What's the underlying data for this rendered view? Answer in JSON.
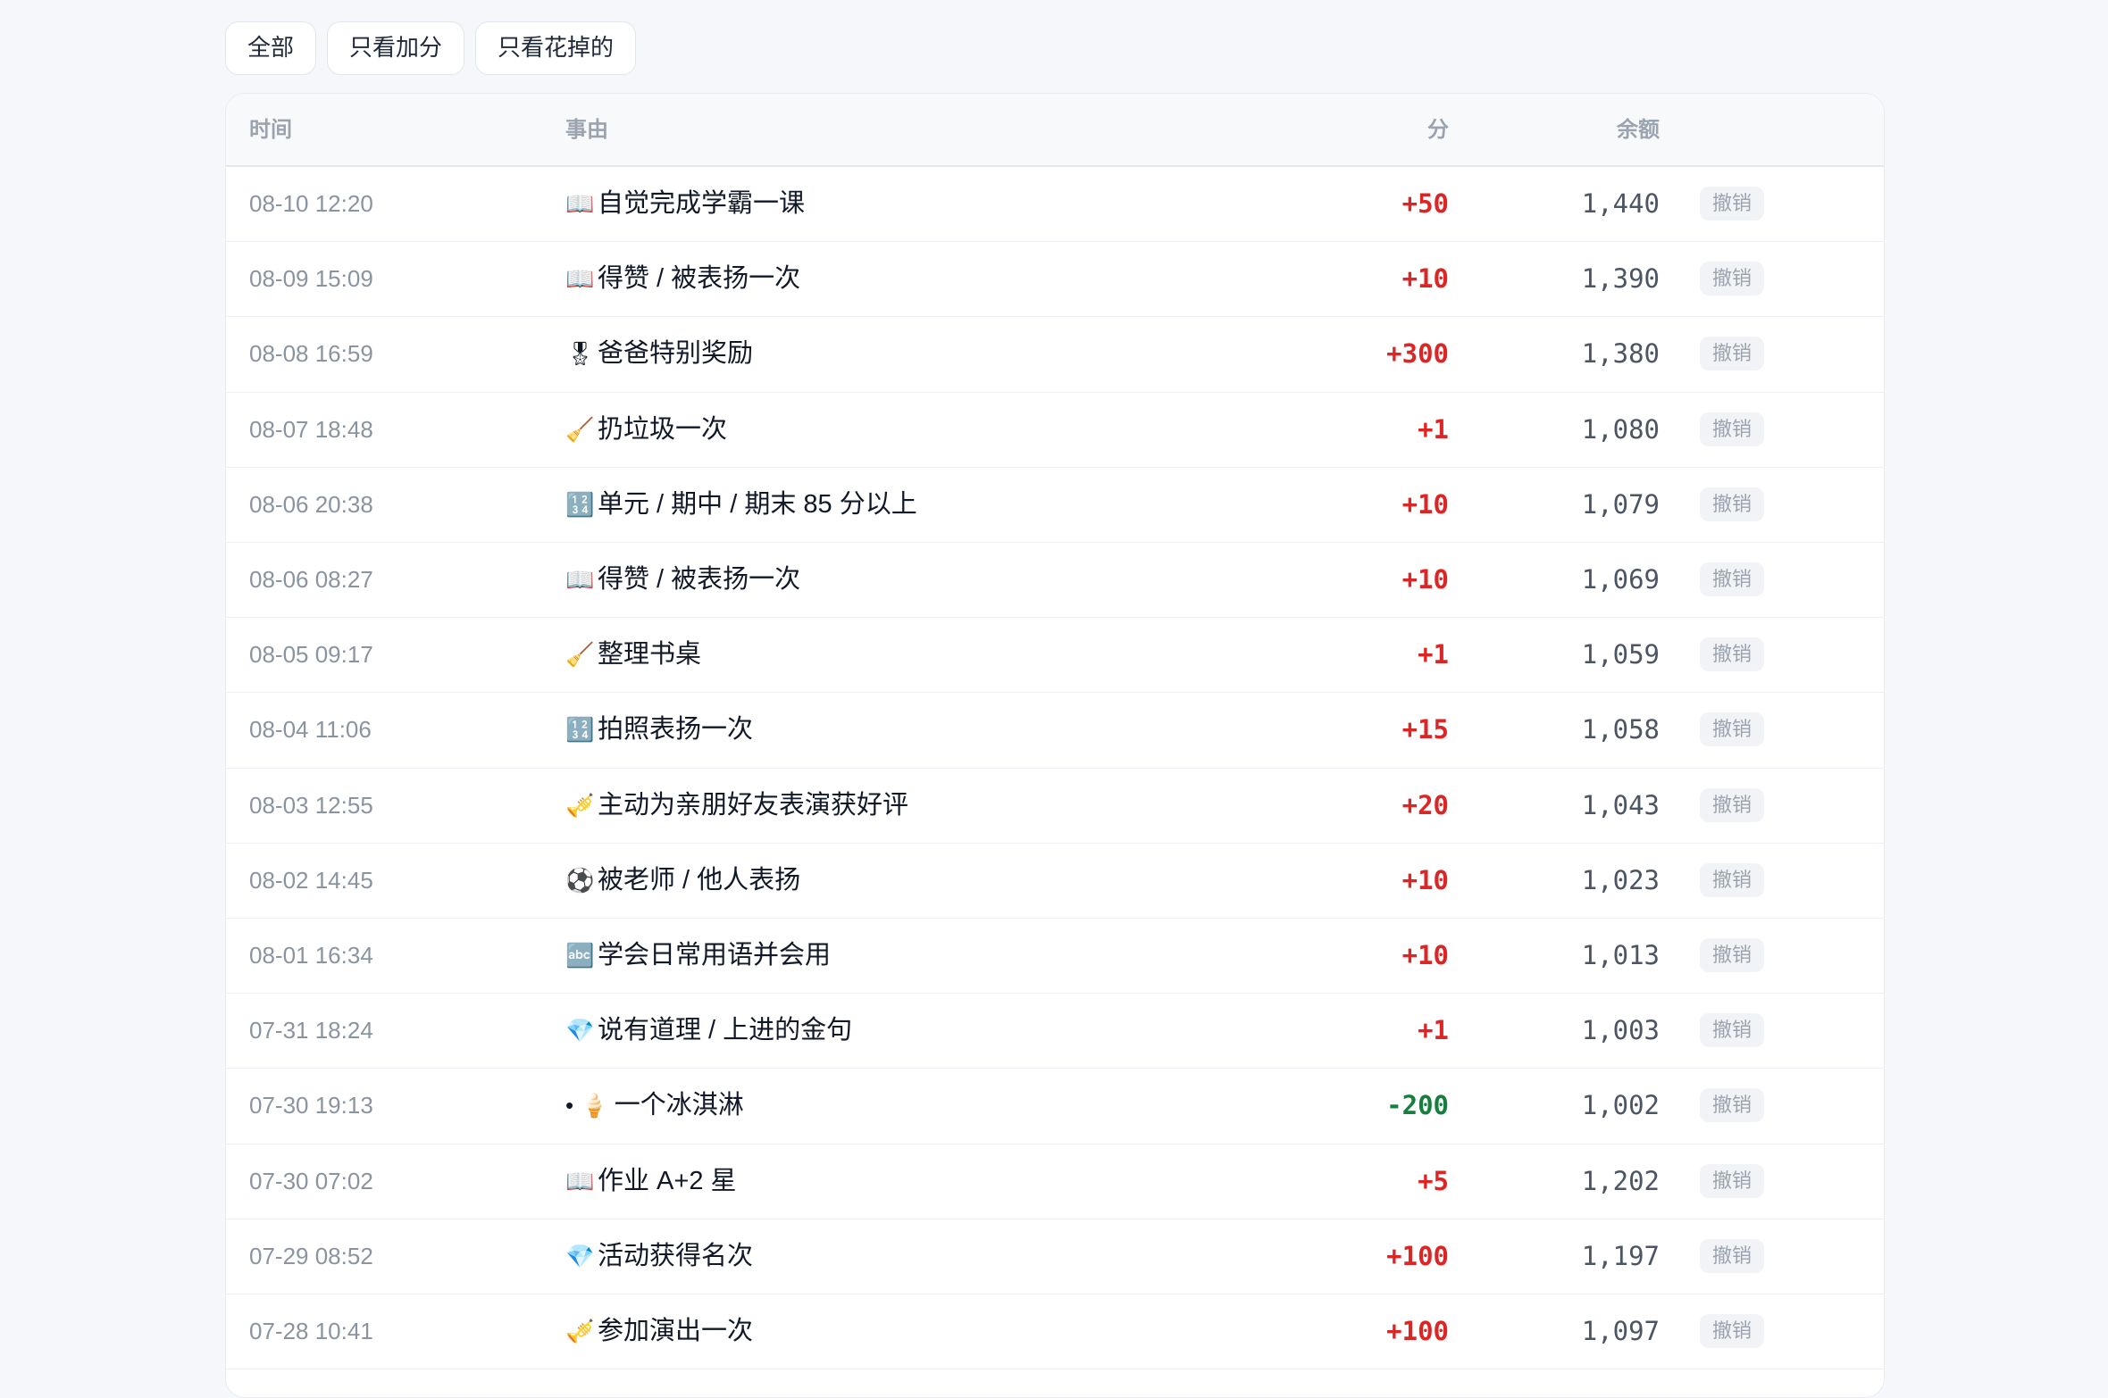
{
  "filters": {
    "all": "全部",
    "plus_only": "只看加分",
    "spent_only": "只看花掉的"
  },
  "table": {
    "headers": {
      "time": "时间",
      "reason": "事由",
      "points": "分",
      "balance": "余额"
    },
    "undo_label": "撤销",
    "colors": {
      "positive": "#dc2626",
      "negative": "#15803d"
    },
    "rows": [
      {
        "time": "08-10 12:20",
        "icon": "📖",
        "icon_name": "book-icon",
        "reason": "自觉完成学霸一课",
        "points": "+50",
        "balance": "1,440"
      },
      {
        "time": "08-09 15:09",
        "icon": "📖",
        "icon_name": "book-icon",
        "reason": "得赞 / 被表扬一次",
        "points": "+10",
        "balance": "1,390"
      },
      {
        "time": "08-08 16:59",
        "icon": "🎖",
        "icon_name": "medal-icon",
        "reason": "爸爸特别奖励",
        "points": "+300",
        "balance": "1,380"
      },
      {
        "time": "08-07 18:48",
        "icon": "🧹",
        "icon_name": "broom-icon",
        "reason": "扔垃圾一次",
        "points": "+1",
        "balance": "1,080"
      },
      {
        "time": "08-06 20:38",
        "icon": "🔢",
        "icon_name": "numbers-icon",
        "reason": "单元 / 期中 / 期末 85 分以上",
        "points": "+10",
        "balance": "1,079"
      },
      {
        "time": "08-06 08:27",
        "icon": "📖",
        "icon_name": "book-icon",
        "reason": "得赞 / 被表扬一次",
        "points": "+10",
        "balance": "1,069"
      },
      {
        "time": "08-05 09:17",
        "icon": "🧹",
        "icon_name": "broom-icon",
        "reason": "整理书桌",
        "points": "+1",
        "balance": "1,059"
      },
      {
        "time": "08-04 11:06",
        "icon": "🔢",
        "icon_name": "numbers-icon",
        "reason": "拍照表扬一次",
        "points": "+15",
        "balance": "1,058"
      },
      {
        "time": "08-03 12:55",
        "icon": "🎺",
        "icon_name": "trumpet-icon",
        "reason": "主动为亲朋好友表演获好评",
        "points": "+20",
        "balance": "1,043"
      },
      {
        "time": "08-02 14:45",
        "icon": "⚽",
        "icon_name": "soccer-ball-icon",
        "reason": "被老师 / 他人表扬",
        "points": "+10",
        "balance": "1,023"
      },
      {
        "time": "08-01 16:34",
        "icon": "🔤",
        "icon_name": "abc-icon",
        "reason": "学会日常用语并会用",
        "points": "+10",
        "balance": "1,013"
      },
      {
        "time": "07-31 18:24",
        "icon": "💎",
        "icon_name": "gem-icon",
        "reason": "说有道理 / 上进的金句",
        "points": "+1",
        "balance": "1,003"
      },
      {
        "time": "07-30 19:13",
        "icon": "• 🍦",
        "icon_name": "ice-cream-icon",
        "reason": "一个冰淇淋",
        "points": "-200",
        "balance": "1,002"
      },
      {
        "time": "07-30 07:02",
        "icon": "📖",
        "icon_name": "book-icon",
        "reason": "作业 A+2 星",
        "points": "+5",
        "balance": "1,202"
      },
      {
        "time": "07-29 08:52",
        "icon": "💎",
        "icon_name": "gem-icon",
        "reason": "活动获得名次",
        "points": "+100",
        "balance": "1,197"
      },
      {
        "time": "07-28 10:41",
        "icon": "🎺",
        "icon_name": "trumpet-icon",
        "reason": "参加演出一次",
        "points": "+100",
        "balance": "1,097"
      }
    ]
  }
}
